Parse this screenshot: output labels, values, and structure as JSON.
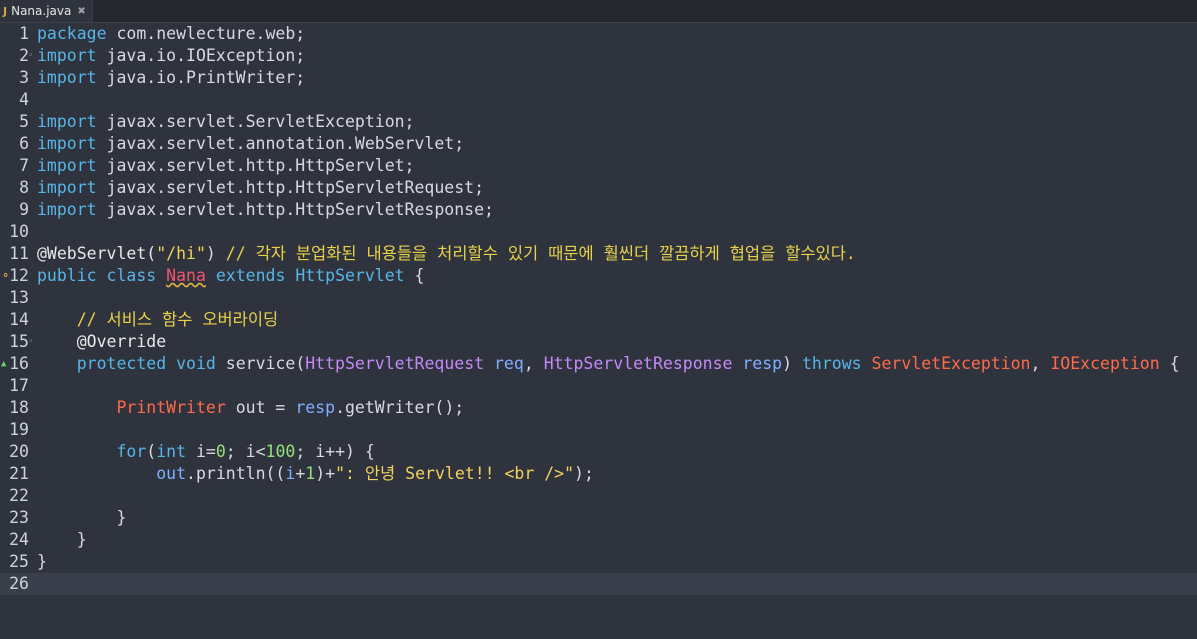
{
  "tab": {
    "filename": "Nana.java",
    "close_glyph": "✖",
    "file_icon": "J"
  },
  "gutter": {
    "lines": [
      "1",
      "2",
      "3",
      "4",
      "5",
      "6",
      "7",
      "8",
      "9",
      "10",
      "11",
      "12",
      "13",
      "14",
      "15",
      "16",
      "17",
      "18",
      "19",
      "20",
      "21",
      "22",
      "23",
      "24",
      "25",
      "26"
    ],
    "fold_marker": "◦",
    "warning_marker": "⚬",
    "override_marker": "▲"
  },
  "code": {
    "l1": {
      "kw": "package",
      "rest": " com.newlecture.web;"
    },
    "l2": {
      "kw": "import",
      "rest": " java.io.IOException;"
    },
    "l3": {
      "kw": "import",
      "rest": " java.io.PrintWriter;"
    },
    "l5": {
      "kw": "import",
      "rest": " javax.servlet.ServletException;"
    },
    "l6": {
      "kw": "import",
      "rest": " javax.servlet.annotation.WebServlet;"
    },
    "l7": {
      "kw": "import",
      "rest": " javax.servlet.http.HttpServlet;"
    },
    "l8": {
      "kw": "import",
      "rest": " javax.servlet.http.HttpServletRequest;"
    },
    "l9": {
      "kw": "import",
      "rest": " javax.servlet.http.HttpServletResponse;"
    },
    "l11": {
      "ann": "@WebServlet(",
      "str": "\"/hi\"",
      "close": ") ",
      "cmt": "// 각자 분업화된 내용들을 처리할수 있기 때문에 훨씬더 깔끔하게 협업을 할수있다."
    },
    "l12": {
      "kw1": "public",
      "kw2": "class",
      "cls": "Nana",
      "kw3": "extends",
      "type": "HttpServlet",
      "rest": " {"
    },
    "l14": {
      "indent": "    ",
      "cmt": "// 서비스 함수 오버라이딩"
    },
    "l15": {
      "indent": "    ",
      "ann": "@Override"
    },
    "l16": {
      "indent": "    ",
      "kw1": "protected",
      "kw2": "void",
      "name": " service(",
      "t1": "HttpServletRequest",
      "p1": "req",
      "comma": ", ",
      "t2": "HttpServletResponse",
      "p2": "resp",
      "close": ") ",
      "kw3": "throws",
      "e1": "ServletException",
      "sep": ", ",
      "e2": "IOException",
      "brace": " {"
    },
    "l18": {
      "indent": "        ",
      "type": "PrintWriter",
      "rest": " out = ",
      "var": "resp",
      "call": ".getWriter();"
    },
    "l20": {
      "indent": "        ",
      "kw": "for",
      "p1": "(",
      "kw2": "int",
      "v1": " i=",
      "n0": "0",
      "s1": "; i<",
      "n100": "100",
      "s2": "; i++) {"
    },
    "l21": {
      "indent": "            ",
      "var": "out",
      "call": ".println((",
      "v": "i",
      "plus": "+",
      "n1": "1",
      "close": ")+",
      "str": "\": 안녕 Servlet!! <br />\"",
      "end": ");"
    },
    "l23": {
      "indent": "        ",
      "text": "}"
    },
    "l24": {
      "indent": "    ",
      "text": "}"
    },
    "l25": {
      "text": "}"
    }
  }
}
